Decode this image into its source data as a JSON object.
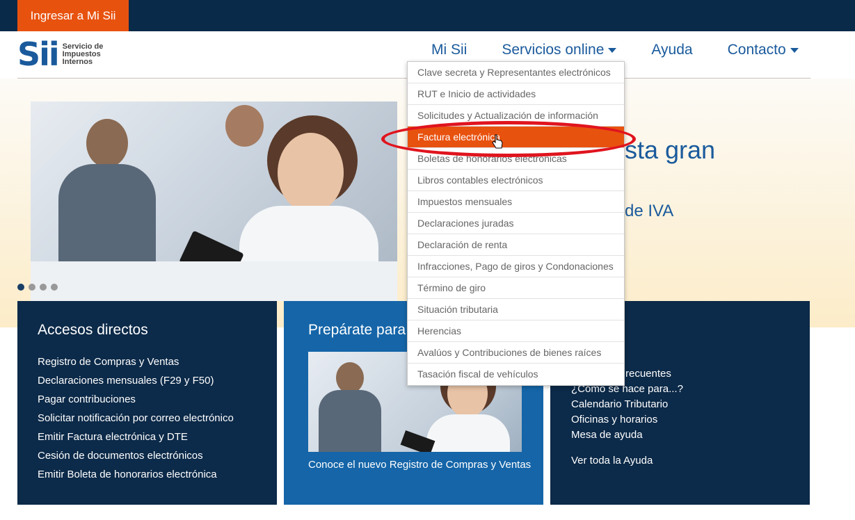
{
  "topbar": {
    "login_label": "Ingresar a Mi Sii"
  },
  "logo": {
    "mark": "Sii",
    "text": "Servicio de\nImpuestos\nInternos"
  },
  "nav": {
    "items": [
      {
        "label": "Mi Sii",
        "has_caret": false
      },
      {
        "label": "Servicios online",
        "has_caret": true
      },
      {
        "label": "Ayuda",
        "has_caret": false
      },
      {
        "label": "Contacto",
        "has_caret": true
      }
    ]
  },
  "hero": {
    "title_visible": "sta gran",
    "subtitle_visible": "de IVA",
    "carousel_dots": 4,
    "active_dot": 1
  },
  "dropdown": {
    "items": [
      "Clave secreta y Representantes electrónicos",
      "RUT e Inicio de actividades",
      "Solicitudes y Actualización de información",
      "Factura electrónica",
      "Boletas de honorarios electrónicas",
      "Libros contables electrónicos",
      "Impuestos mensuales",
      "Declaraciones juradas",
      "Declaración de renta",
      "Infracciones, Pago de giros y Condonaciones",
      "Término de giro",
      "Situación tributaria",
      "Herencias",
      "Avalúos y Contribuciones de bienes raíces",
      "Tasación fiscal de vehículos"
    ],
    "active_index": 3
  },
  "accesos": {
    "title": "Accesos directos",
    "links": [
      "Registro de Compras y Ventas",
      "Declaraciones mensuales (F29 y F50)",
      "Pagar contribuciones",
      "Solicitar notificación por correo electrónico",
      "Emitir Factura electrónica y DTE",
      "Cesión de documentos electrónicos",
      "Emitir Boleta de honorarios electrónica"
    ]
  },
  "preparate": {
    "title_visible": "Prepárate para",
    "link": "Conoce el nuevo Registro de Compras y Ventas"
  },
  "ayuda": {
    "links_visible": [
      "s",
      "recuentes",
      "¿Cómo se hace para...?",
      "Calendario Tributario",
      "Oficinas y horarios",
      "Mesa de ayuda"
    ],
    "view_all": "Ver toda la Ayuda"
  },
  "colors": {
    "navy": "#0a2a49",
    "orange": "#e8520f",
    "blue": "#1565a8",
    "link_blue": "#1a5a9c",
    "highlight_red": "#e0141e"
  }
}
